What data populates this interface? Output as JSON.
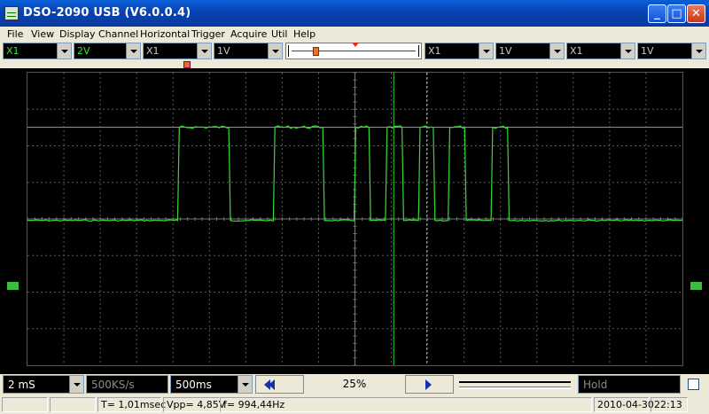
{
  "window": {
    "title": "DSO-2090 USB (V6.0.0.4)"
  },
  "menu": [
    "File",
    "View",
    "Display",
    "Channel",
    "Horizontal",
    "Trigger",
    "Acquire",
    "Util",
    "Help"
  ],
  "toolbar": {
    "ch1_probe": "X1",
    "ch1_volts": "2V",
    "ch2_probe": "X1",
    "ch2_volts": "1V",
    "ch3_probe": "X1",
    "ch3_volts": "1V",
    "ch4_probe": "X1",
    "ch4_volts": "1V"
  },
  "colors": {
    "trace": "#39d839",
    "grid": "#5a5a5a",
    "cursor": "#2bd42b",
    "ch1_fg": "#39e639",
    "ch_fg": "#c8c8c8"
  },
  "bottom": {
    "timebase": "2 mS",
    "sample_rate": "500KS/s",
    "record_length": "500ms",
    "position_percent": "25%",
    "hold": "Hold"
  },
  "status": {
    "period": "T= 1,01msec",
    "vpp": "Vpp= 4,85V",
    "freq": "f= 994,44Hz",
    "date": "2010-04-30",
    "time": "22:13"
  },
  "chart_data": {
    "type": "line",
    "series": [
      {
        "values_description": "digital pulse train",
        "x_div": [
          0,
          4.55,
          4.6,
          6.1,
          6.15,
          7.45,
          7.5,
          8.95,
          9.0,
          9.9,
          9.95,
          10.35,
          10.4,
          10.85,
          10.9,
          11.35,
          11.4,
          11.85,
          11.9,
          12.3,
          12.35,
          12.75,
          12.8,
          13.25,
          13.3,
          14.05,
          14.1,
          14.55,
          14.6,
          15.1,
          15.15,
          19.85
        ],
        "y_div": [
          0,
          0,
          2.55,
          2.55,
          0,
          0,
          2.55,
          2.55,
          0,
          0,
          2.55,
          2.55,
          0,
          0,
          2.55,
          2.55,
          0,
          0,
          2.55,
          2.55,
          0,
          0,
          2.55,
          2.55,
          0,
          0,
          2.55,
          2.55,
          0,
          0,
          0,
          0
        ]
      }
    ],
    "cursors": {
      "horizontal_y_div": 2.55,
      "vertical_x_div": [
        11.1,
        12.1
      ]
    },
    "grid": {
      "divisions_x": 18,
      "divisions_y": 8
    }
  }
}
